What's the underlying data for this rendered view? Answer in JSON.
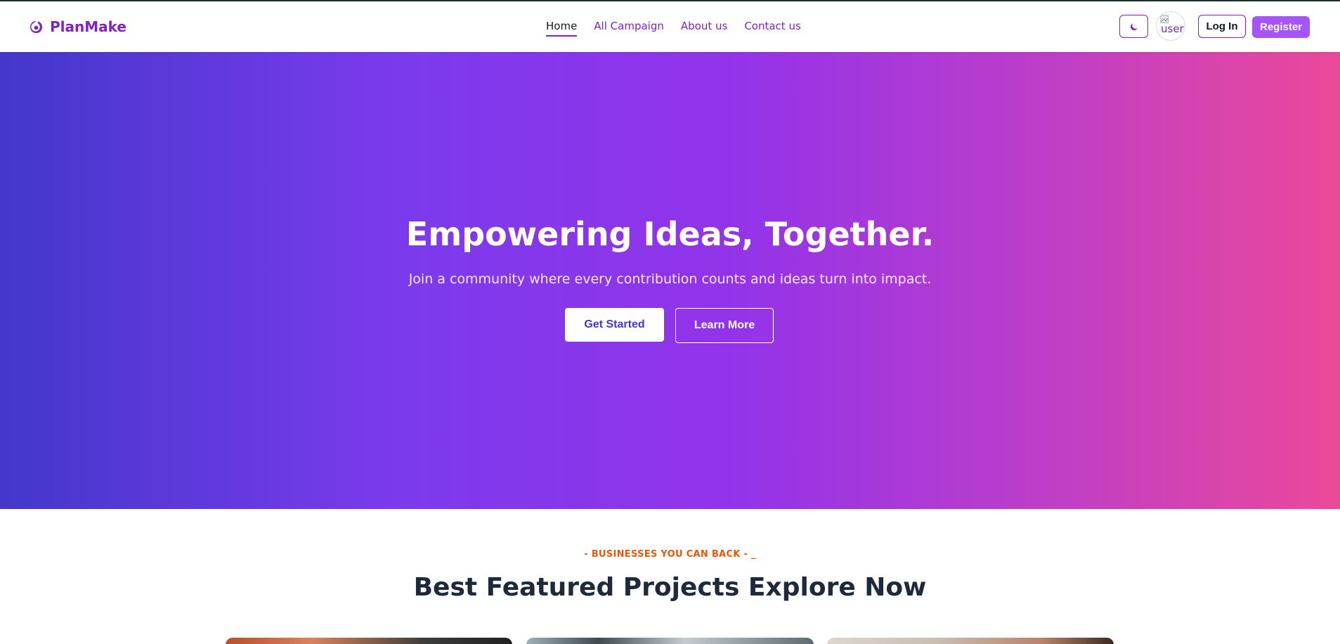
{
  "brand": {
    "name": "PlanMake",
    "color": "#7e22ce"
  },
  "nav": {
    "links": [
      {
        "label": "Home",
        "active": true
      },
      {
        "label": "All Campaign",
        "active": false
      },
      {
        "label": "About us",
        "active": false
      },
      {
        "label": "Contact us",
        "active": false
      }
    ],
    "theme_toggle_icon": "moon-icon",
    "avatar_alt": "user",
    "login_label": "Log In",
    "register_label": "Register"
  },
  "hero": {
    "title": "Empowering Ideas, Together.",
    "subtitle": "Join a community where every contribution counts and ideas turn into impact.",
    "primary_cta": "Get Started",
    "secondary_cta": "Learn More",
    "gradient": [
      "#4338ca",
      "#9333ea",
      "#ec4899"
    ]
  },
  "featured": {
    "eyebrow": "- BUSINESSES YOU CAN BACK - _",
    "title": "Best Featured Projects Explore Now",
    "accent_color": "#ea580c"
  }
}
